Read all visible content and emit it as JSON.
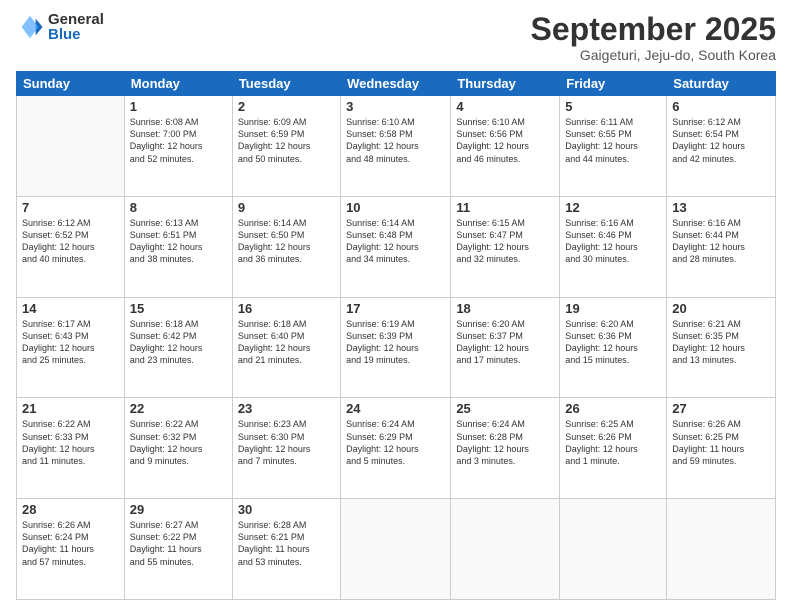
{
  "logo": {
    "general": "General",
    "blue": "Blue"
  },
  "title": "September 2025",
  "subtitle": "Gaigeturi, Jeju-do, South Korea",
  "headers": [
    "Sunday",
    "Monday",
    "Tuesday",
    "Wednesday",
    "Thursday",
    "Friday",
    "Saturday"
  ],
  "weeks": [
    [
      {
        "day": "",
        "info": ""
      },
      {
        "day": "1",
        "info": "Sunrise: 6:08 AM\nSunset: 7:00 PM\nDaylight: 12 hours\nand 52 minutes."
      },
      {
        "day": "2",
        "info": "Sunrise: 6:09 AM\nSunset: 6:59 PM\nDaylight: 12 hours\nand 50 minutes."
      },
      {
        "day": "3",
        "info": "Sunrise: 6:10 AM\nSunset: 6:58 PM\nDaylight: 12 hours\nand 48 minutes."
      },
      {
        "day": "4",
        "info": "Sunrise: 6:10 AM\nSunset: 6:56 PM\nDaylight: 12 hours\nand 46 minutes."
      },
      {
        "day": "5",
        "info": "Sunrise: 6:11 AM\nSunset: 6:55 PM\nDaylight: 12 hours\nand 44 minutes."
      },
      {
        "day": "6",
        "info": "Sunrise: 6:12 AM\nSunset: 6:54 PM\nDaylight: 12 hours\nand 42 minutes."
      }
    ],
    [
      {
        "day": "7",
        "info": "Sunrise: 6:12 AM\nSunset: 6:52 PM\nDaylight: 12 hours\nand 40 minutes."
      },
      {
        "day": "8",
        "info": "Sunrise: 6:13 AM\nSunset: 6:51 PM\nDaylight: 12 hours\nand 38 minutes."
      },
      {
        "day": "9",
        "info": "Sunrise: 6:14 AM\nSunset: 6:50 PM\nDaylight: 12 hours\nand 36 minutes."
      },
      {
        "day": "10",
        "info": "Sunrise: 6:14 AM\nSunset: 6:48 PM\nDaylight: 12 hours\nand 34 minutes."
      },
      {
        "day": "11",
        "info": "Sunrise: 6:15 AM\nSunset: 6:47 PM\nDaylight: 12 hours\nand 32 minutes."
      },
      {
        "day": "12",
        "info": "Sunrise: 6:16 AM\nSunset: 6:46 PM\nDaylight: 12 hours\nand 30 minutes."
      },
      {
        "day": "13",
        "info": "Sunrise: 6:16 AM\nSunset: 6:44 PM\nDaylight: 12 hours\nand 28 minutes."
      }
    ],
    [
      {
        "day": "14",
        "info": "Sunrise: 6:17 AM\nSunset: 6:43 PM\nDaylight: 12 hours\nand 25 minutes."
      },
      {
        "day": "15",
        "info": "Sunrise: 6:18 AM\nSunset: 6:42 PM\nDaylight: 12 hours\nand 23 minutes."
      },
      {
        "day": "16",
        "info": "Sunrise: 6:18 AM\nSunset: 6:40 PM\nDaylight: 12 hours\nand 21 minutes."
      },
      {
        "day": "17",
        "info": "Sunrise: 6:19 AM\nSunset: 6:39 PM\nDaylight: 12 hours\nand 19 minutes."
      },
      {
        "day": "18",
        "info": "Sunrise: 6:20 AM\nSunset: 6:37 PM\nDaylight: 12 hours\nand 17 minutes."
      },
      {
        "day": "19",
        "info": "Sunrise: 6:20 AM\nSunset: 6:36 PM\nDaylight: 12 hours\nand 15 minutes."
      },
      {
        "day": "20",
        "info": "Sunrise: 6:21 AM\nSunset: 6:35 PM\nDaylight: 12 hours\nand 13 minutes."
      }
    ],
    [
      {
        "day": "21",
        "info": "Sunrise: 6:22 AM\nSunset: 6:33 PM\nDaylight: 12 hours\nand 11 minutes."
      },
      {
        "day": "22",
        "info": "Sunrise: 6:22 AM\nSunset: 6:32 PM\nDaylight: 12 hours\nand 9 minutes."
      },
      {
        "day": "23",
        "info": "Sunrise: 6:23 AM\nSunset: 6:30 PM\nDaylight: 12 hours\nand 7 minutes."
      },
      {
        "day": "24",
        "info": "Sunrise: 6:24 AM\nSunset: 6:29 PM\nDaylight: 12 hours\nand 5 minutes."
      },
      {
        "day": "25",
        "info": "Sunrise: 6:24 AM\nSunset: 6:28 PM\nDaylight: 12 hours\nand 3 minutes."
      },
      {
        "day": "26",
        "info": "Sunrise: 6:25 AM\nSunset: 6:26 PM\nDaylight: 12 hours\nand 1 minute."
      },
      {
        "day": "27",
        "info": "Sunrise: 6:26 AM\nSunset: 6:25 PM\nDaylight: 11 hours\nand 59 minutes."
      }
    ],
    [
      {
        "day": "28",
        "info": "Sunrise: 6:26 AM\nSunset: 6:24 PM\nDaylight: 11 hours\nand 57 minutes."
      },
      {
        "day": "29",
        "info": "Sunrise: 6:27 AM\nSunset: 6:22 PM\nDaylight: 11 hours\nand 55 minutes."
      },
      {
        "day": "30",
        "info": "Sunrise: 6:28 AM\nSunset: 6:21 PM\nDaylight: 11 hours\nand 53 minutes."
      },
      {
        "day": "",
        "info": ""
      },
      {
        "day": "",
        "info": ""
      },
      {
        "day": "",
        "info": ""
      },
      {
        "day": "",
        "info": ""
      }
    ]
  ]
}
